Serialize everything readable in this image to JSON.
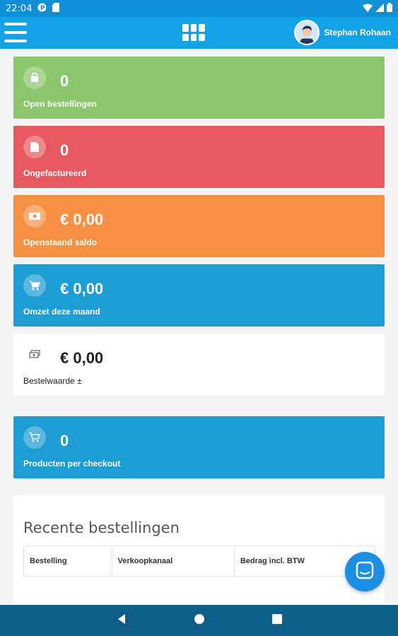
{
  "status_bar": {
    "time": "22:04"
  },
  "header": {
    "user_name": "Stephan Rohaan"
  },
  "cards": [
    {
      "value": "0",
      "label": "Open bestellingen",
      "color": "#8cc66b",
      "icon": "shopping-bag-icon"
    },
    {
      "value": "0",
      "label": "Ongefactureerd",
      "color": "#e65a5f",
      "icon": "document-icon"
    },
    {
      "value": "€ 0,00",
      "label": "Openstaand saldo",
      "color": "#f79043",
      "icon": "money-icon"
    },
    {
      "value": "€ 0,00",
      "label": "Omzet deze maand",
      "color": "#1c9dd3",
      "icon": "cart-icon"
    },
    {
      "value": "€ 0,00",
      "label": "Bestelwaarde ±",
      "color": "#ffffff",
      "icon": "cash-stack-icon"
    },
    {
      "value": "0",
      "label": "Producten per checkout",
      "color": "#1c9dd3",
      "icon": "cart-outline-icon"
    }
  ],
  "recent_orders": {
    "title": "Recente bestellingen",
    "columns": [
      "Bestelling",
      "Verkoopkanaal",
      "Bedrag incl. BTW"
    ]
  }
}
